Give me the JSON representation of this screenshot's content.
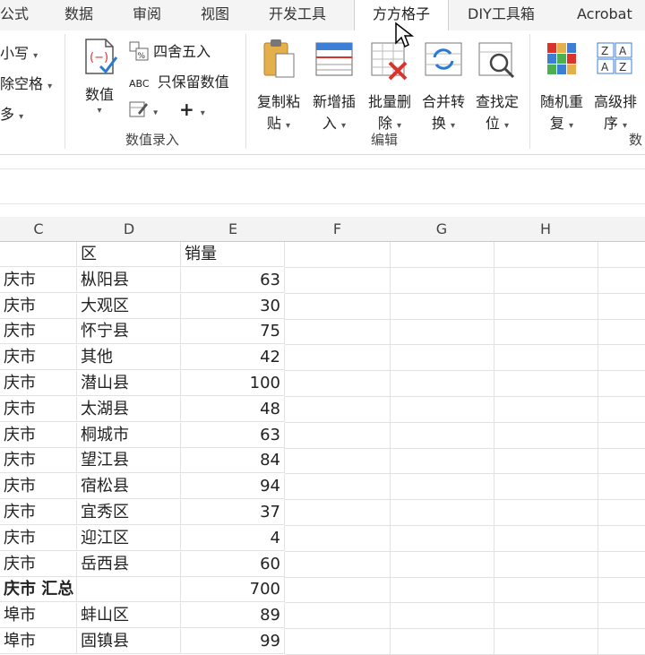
{
  "tabs": [
    {
      "label": "公式"
    },
    {
      "label": "数据"
    },
    {
      "label": "审阅"
    },
    {
      "label": "视图"
    },
    {
      "label": "开发工具"
    },
    {
      "label": "方方格子"
    },
    {
      "label": "DIY工具箱"
    },
    {
      "label": "Acrobat"
    }
  ],
  "ribbon": {
    "left_cut": {
      "item1": "小写",
      "item2": "除空格",
      "item3": "多"
    },
    "value_group": {
      "numeric_label": "数值",
      "round_label": "四舍五入",
      "keep_values_label": "只保留数值",
      "abc_glyph": "ABC",
      "plus_glyph": "+",
      "group_label": "数值录入"
    },
    "edit_group": {
      "buttons": [
        {
          "line1": "复制粘",
          "line2": "贴"
        },
        {
          "line1": "新增插",
          "line2": "入"
        },
        {
          "line1": "批量删",
          "line2": "除"
        },
        {
          "line1": "合并转",
          "line2": "换"
        },
        {
          "line1": "查找定",
          "line2": "位"
        }
      ],
      "group_label": "编辑"
    },
    "data_group": {
      "buttons": [
        {
          "line1": "随机重",
          "line2": "复"
        },
        {
          "line1": "高级排",
          "line2": "序"
        }
      ],
      "group_label_cut": "数"
    }
  },
  "grid": {
    "columns": [
      "C",
      "D",
      "E",
      "F",
      "G",
      "H"
    ],
    "header_row": {
      "c": "",
      "d": "区",
      "e": "销量"
    },
    "rows": [
      {
        "c": "庆市",
        "d": "枞阳县",
        "e": "63"
      },
      {
        "c": "庆市",
        "d": "大观区",
        "e": "30"
      },
      {
        "c": "庆市",
        "d": "怀宁县",
        "e": "75"
      },
      {
        "c": "庆市",
        "d": "其他",
        "e": "42"
      },
      {
        "c": "庆市",
        "d": "潜山县",
        "e": "100"
      },
      {
        "c": "庆市",
        "d": "太湖县",
        "e": "48"
      },
      {
        "c": "庆市",
        "d": "桐城市",
        "e": "63"
      },
      {
        "c": "庆市",
        "d": "望江县",
        "e": "84"
      },
      {
        "c": "庆市",
        "d": "宿松县",
        "e": "94"
      },
      {
        "c": "庆市",
        "d": "宜秀区",
        "e": "37"
      },
      {
        "c": "庆市",
        "d": "迎江区",
        "e": "4"
      },
      {
        "c": "庆市",
        "d": "岳西县",
        "e": "60"
      },
      {
        "c": "庆市 汇总",
        "d": "",
        "e": "700",
        "bold": true
      },
      {
        "c": "埠市",
        "d": "蚌山区",
        "e": "89"
      },
      {
        "c": "埠市",
        "d": "固镇县",
        "e": "99"
      }
    ]
  }
}
